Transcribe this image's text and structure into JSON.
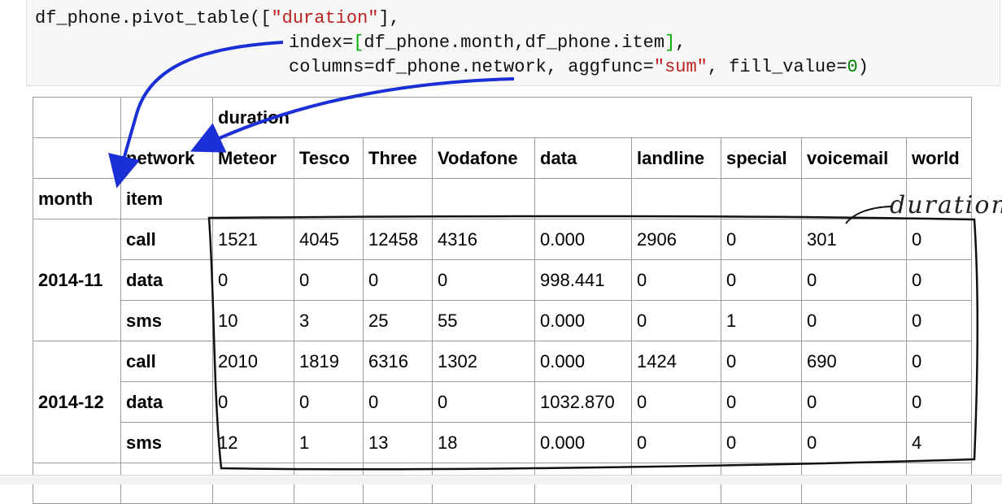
{
  "code": {
    "line1_fn": "df_phone.pivot_table([",
    "line1_str": "\"duration\"",
    "line1_end": "],",
    "line2_pre": "index=",
    "line2_open": "[",
    "line2_mid": "df_phone.month,df_phone.item",
    "line2_close": "]",
    "line2_end": ",",
    "line3_pre": "columns=df_phone.network, aggfunc=",
    "line3_str": "\"sum\"",
    "line3_mid": ", fill_value=",
    "line3_num": "0",
    "line3_end": ")"
  },
  "table": {
    "top_header": "duration",
    "columns_name": "network",
    "columns": [
      "Meteor",
      "Tesco",
      "Three",
      "Vodafone",
      "data",
      "landline",
      "special",
      "voicemail",
      "world"
    ],
    "index_names": [
      "month",
      "item"
    ],
    "groups": [
      {
        "month": "2014-11",
        "rows": [
          {
            "item": "call",
            "values": [
              "1521",
              "4045",
              "12458",
              "4316",
              "0.000",
              "2906",
              "0",
              "301",
              "0"
            ]
          },
          {
            "item": "data",
            "values": [
              "0",
              "0",
              "0",
              "0",
              "998.441",
              "0",
              "0",
              "0",
              "0"
            ]
          },
          {
            "item": "sms",
            "values": [
              "10",
              "3",
              "25",
              "55",
              "0.000",
              "0",
              "1",
              "0",
              "0"
            ]
          }
        ]
      },
      {
        "month": "2014-12",
        "rows": [
          {
            "item": "call",
            "values": [
              "2010",
              "1819",
              "6316",
              "1302",
              "0.000",
              "1424",
              "0",
              "690",
              "0"
            ]
          },
          {
            "item": "data",
            "values": [
              "0",
              "0",
              "0",
              "0",
              "1032.870",
              "0",
              "0",
              "0",
              "0"
            ]
          },
          {
            "item": "sms",
            "values": [
              "12",
              "1",
              "13",
              "18",
              "0.000",
              "0",
              "0",
              "0",
              "4"
            ]
          }
        ]
      }
    ]
  },
  "annotation": {
    "handwritten_label": "duration",
    "arrow_color": "#1a2fd6",
    "ink_color": "#111111"
  }
}
